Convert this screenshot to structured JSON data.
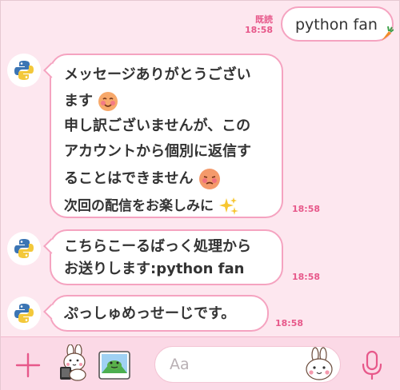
{
  "outgoing": {
    "text": "python fan",
    "read_label": "既読",
    "time": "18:58"
  },
  "messages": [
    {
      "lines": [
        "メッセージありがとうござい",
        "ます",
        "申し訳ございませんが、この",
        "アカウントから個別に返信す",
        "ることはできません",
        "次回の配信をお楽しみに"
      ],
      "time": "18:58"
    },
    {
      "lines": [
        "こちらこーるばっく処理から",
        "お送りします:python fan"
      ],
      "time": "18:58"
    },
    {
      "lines": [
        "ぷっしゅめっせーじです。"
      ],
      "time": "18:58"
    }
  ],
  "input": {
    "placeholder": "Aa"
  },
  "icons": {
    "avatar": "python-logo-icon",
    "add": "plus-icon",
    "sticker": "sticker-icon",
    "photo": "photo-icon",
    "emoji": "bunny-face-icon",
    "mic": "microphone-icon"
  },
  "colors": {
    "background": "#fde7ef",
    "accent": "#e7588a",
    "bubble_border": "#f5a3c0"
  }
}
